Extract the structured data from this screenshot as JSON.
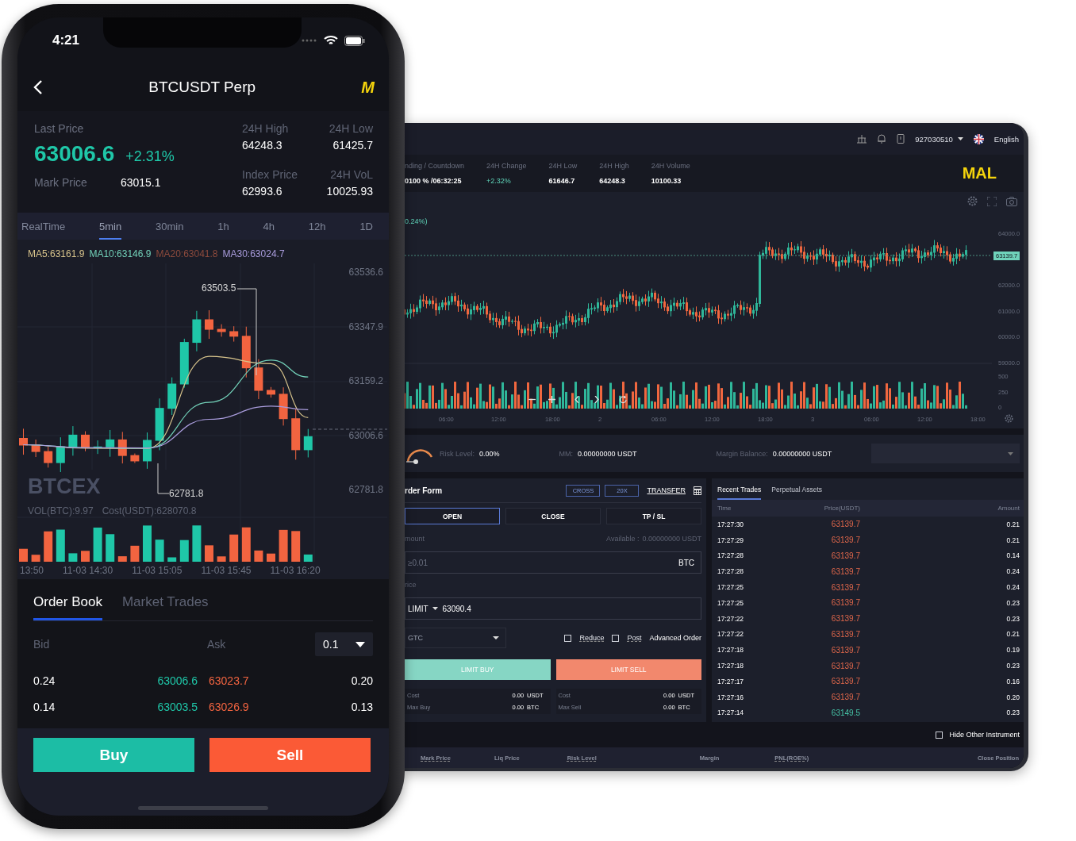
{
  "phone": {
    "status_bar": {
      "time": "4:21"
    },
    "header": {
      "title": "BTCUSDT Perp",
      "logo": "M"
    },
    "ticker": {
      "last_price_label": "Last Price",
      "last_price": "63006.6",
      "change": "+2.31%",
      "mark_price_label": "Mark Price",
      "mark_price": "63015.1",
      "stats": [
        {
          "label": "24H High",
          "value": "64248.3"
        },
        {
          "label": "24H Low",
          "value": "61425.7"
        },
        {
          "label": "Index Price",
          "value": "62993.6"
        },
        {
          "label": "24H VoL",
          "value": "10025.93"
        }
      ]
    },
    "intervals": [
      {
        "label": "RealTime",
        "selected": false
      },
      {
        "label": "5min",
        "selected": true
      },
      {
        "label": "30min",
        "selected": false
      },
      {
        "label": "1h",
        "selected": false
      },
      {
        "label": "4h",
        "selected": false
      },
      {
        "label": "12h",
        "selected": false
      },
      {
        "label": "1D",
        "selected": false
      }
    ],
    "chart": {
      "indicators": [
        {
          "text": "MA5:63161.9",
          "color": "#d8c48c"
        },
        {
          "text": "MA10:63146.9",
          "color": "#72d0b8"
        },
        {
          "text": "MA20:63041.8",
          "color": "#8c4a3c"
        },
        {
          "text": "MA30:63024.7",
          "color": "#a99cdc"
        }
      ],
      "price_axis": [
        "63536.6",
        "63347.9",
        "63159.2",
        "63006.6",
        "62781.8"
      ],
      "high_marker": "63503.5",
      "low_marker": "62781.8",
      "watermark": "BTCEX",
      "volume_legend": [
        "VOL(BTC):9.97",
        "Cost(USDT):628070.8"
      ],
      "time_axis": [
        "13:50",
        "11-03 14:30",
        "11-03 15:05",
        "11-03 15:45",
        "11-03 16:20"
      ]
    },
    "book_tabs": [
      {
        "label": "Order Book",
        "selected": true
      },
      {
        "label": "Market Trades",
        "selected": false
      }
    ],
    "order_book": {
      "columns": [
        "Bid",
        "Ask"
      ],
      "precision": "0.1",
      "rows": [
        {
          "bid_amount": "0.24",
          "bid_price": "63006.6",
          "ask_price": "63023.7",
          "ask_amount": "0.20"
        },
        {
          "bid_amount": "0.14",
          "bid_price": "63003.5",
          "ask_price": "63026.9",
          "ask_amount": "0.13"
        }
      ]
    },
    "buttons": [
      {
        "label": "Buy",
        "kind": "buy"
      },
      {
        "label": "Sell",
        "kind": "sell"
      }
    ]
  },
  "tablet": {
    "top_bar": {
      "account": "927030510",
      "language": "English"
    },
    "ticker": {
      "stats": [
        {
          "label": "nding / Countdown",
          "value": "0100 % /06:32:25",
          "kind": "plain"
        },
        {
          "label": "24H Change",
          "value": "+2.32%",
          "kind": "up"
        },
        {
          "label": "24H Low",
          "value": "61646.7",
          "kind": "plain"
        },
        {
          "label": "24H High",
          "value": "64248.3",
          "kind": "plain"
        },
        {
          "label": "24H Volume",
          "value": "10100.33",
          "kind": "plain"
        }
      ],
      "logo": "MAL"
    },
    "chart": {
      "legend": "0.24%)",
      "price_axis": [
        "64000.0",
        "62000.0",
        "61000.0",
        "60000.0",
        "59000.0"
      ],
      "last_price": "63139.7",
      "volume_axis": [
        "500",
        "250",
        "0"
      ],
      "time_axis": [
        "06:00",
        "12:00",
        "18:00",
        "2",
        "06:00",
        "12:00",
        "18:00",
        "3",
        "06:00",
        "12:00",
        "18:00"
      ]
    },
    "risk": {
      "risk_label": "Risk Level:",
      "risk_value": "0.00%",
      "mm_label": "MM:",
      "mm_value": "0.00000000 USDT",
      "balance_label": "Margin Balance:",
      "balance_value": "0.00000000 USDT"
    },
    "order_form": {
      "title": "rder Form",
      "margin_mode": "CROSS",
      "leverage": "20X",
      "transfer": "TRANSFER",
      "tabs": [
        {
          "label": "OPEN",
          "selected": true
        },
        {
          "label": "CLOSE",
          "selected": false
        },
        {
          "label": "TP / SL",
          "selected": false
        }
      ],
      "amount_label": "mount",
      "available_label": "Available :",
      "available_value": "0.00000000 USDT",
      "amount_placeholder": "≥0.01",
      "amount_unit": "BTC",
      "price_label": "rice",
      "price_type": "LIMIT",
      "price_value": "63090.4",
      "time_in_force": "GTC",
      "options": [
        {
          "label": "Reduce",
          "checked": false
        },
        {
          "label": "Post",
          "checked": false
        }
      ],
      "advanced": "Advanced Order",
      "actions": [
        {
          "label": "LIMIT BUY",
          "kind": "buy"
        },
        {
          "label": "LIMIT SELL",
          "kind": "sell"
        }
      ],
      "summaries": [
        [
          {
            "label": "Cost",
            "value": "0.00",
            "unit": "USDT"
          },
          {
            "label": "Max Buy",
            "value": "0.00",
            "unit": "BTC"
          }
        ],
        [
          {
            "label": "Cost",
            "value": "0.00",
            "unit": "USDT"
          },
          {
            "label": "Max Sell",
            "value": "0.00",
            "unit": "BTC"
          }
        ]
      ]
    },
    "trades": {
      "tabs": [
        {
          "label": "Recent Trades",
          "selected": true
        },
        {
          "label": "Perpetual Assets",
          "selected": false
        }
      ],
      "columns": [
        "Time",
        "Price(USDT)",
        "Amount"
      ],
      "rows": [
        {
          "time": "17:27:30",
          "price": "63139.7",
          "amount": "0.21",
          "color": "#e0674b"
        },
        {
          "time": "17:27:29",
          "price": "63139.7",
          "amount": "0.21",
          "color": "#e0674b"
        },
        {
          "time": "17:27:28",
          "price": "63139.7",
          "amount": "0.14",
          "color": "#e0674b"
        },
        {
          "time": "17:27:28",
          "price": "63139.7",
          "amount": "0.24",
          "color": "#e0674b"
        },
        {
          "time": "17:27:25",
          "price": "63139.7",
          "amount": "0.24",
          "color": "#e0674b"
        },
        {
          "time": "17:27:25",
          "price": "63139.7",
          "amount": "0.23",
          "color": "#e0674b"
        },
        {
          "time": "17:27:22",
          "price": "63139.7",
          "amount": "0.23",
          "color": "#e0674b"
        },
        {
          "time": "17:27:22",
          "price": "63139.7",
          "amount": "0.21",
          "color": "#e0674b"
        },
        {
          "time": "17:27:18",
          "price": "63139.7",
          "amount": "0.19",
          "color": "#e0674b"
        },
        {
          "time": "17:27:18",
          "price": "63139.7",
          "amount": "0.23",
          "color": "#e0674b"
        },
        {
          "time": "17:27:17",
          "price": "63139.7",
          "amount": "0.16",
          "color": "#e0674b"
        },
        {
          "time": "17:27:16",
          "price": "63139.7",
          "amount": "0.20",
          "color": "#e0674b"
        },
        {
          "time": "17:27:14",
          "price": "63149.5",
          "amount": "0.23",
          "color": "#46c3a6"
        }
      ]
    },
    "positions": {
      "hide_other": {
        "label": "Hide Other Instrument",
        "checked": false
      },
      "columns": [
        "Mark Price",
        "Liq Price",
        "Risk Level",
        "Margin",
        "PNL(ROE%)",
        "Close Position"
      ]
    }
  }
}
